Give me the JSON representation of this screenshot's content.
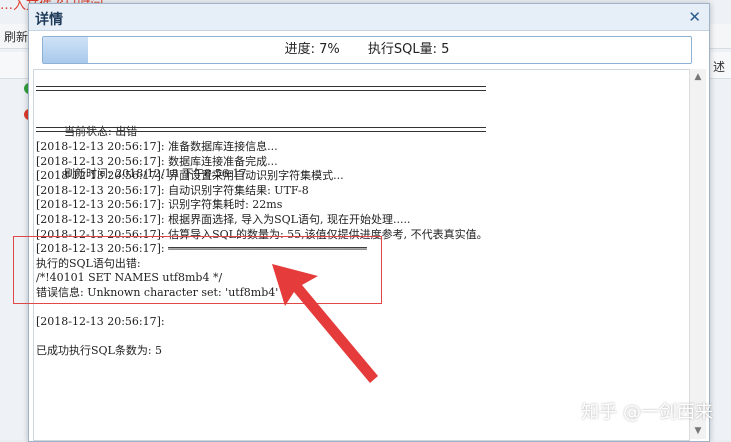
{
  "background": {
    "top_text": "…入文件\tß日时间",
    "refresh_label": "刷新",
    "description_label": "述"
  },
  "modal": {
    "title": "详情",
    "close_icon": "close-icon"
  },
  "progress": {
    "label": "进度: 7%",
    "sql_count_label": "执行SQL量: 5",
    "percent": 0.07
  },
  "status": {
    "state_line": "当前状态: 出错",
    "refresh_line": "刷新时间: 2018/12/13 下午8:56:17"
  },
  "log": [
    "[2018-12-13 20:56:17]: 准备数据库连接信息...",
    "[2018-12-13 20:56:17]: 数据库连接准备完成...",
    "[2018-12-13 20:56:17]: 界面设置采用自动识别字符集模式...",
    "[2018-12-13 20:56:17]: 自动识别字符集结果: UTF-8",
    "[2018-12-13 20:56:17]: 识别字符集耗时: 22ms",
    "[2018-12-13 20:56:17]: 根据界面选择, 导入为SQL语句, 现在开始处理.....",
    "[2018-12-13 20:56:17]: 估算导入SQL的数量为: 55,该值仅提供进度参考, 不代表真实值。",
    "[2018-12-13 20:56:17]: ══════════════════════════════",
    "执行的SQL语句出错:",
    "/*!40101 SET NAMES utf8mb4 */",
    "错误信息: Unknown character set: 'utf8mb4'",
    "",
    "[2018-12-13 20:56:17]:",
    "",
    "已成功执行SQL条数为: 5"
  ],
  "watermark": "知乎 @一剑西来",
  "colors": {
    "accent": "#8db2d6",
    "annotation": "#e04848"
  }
}
